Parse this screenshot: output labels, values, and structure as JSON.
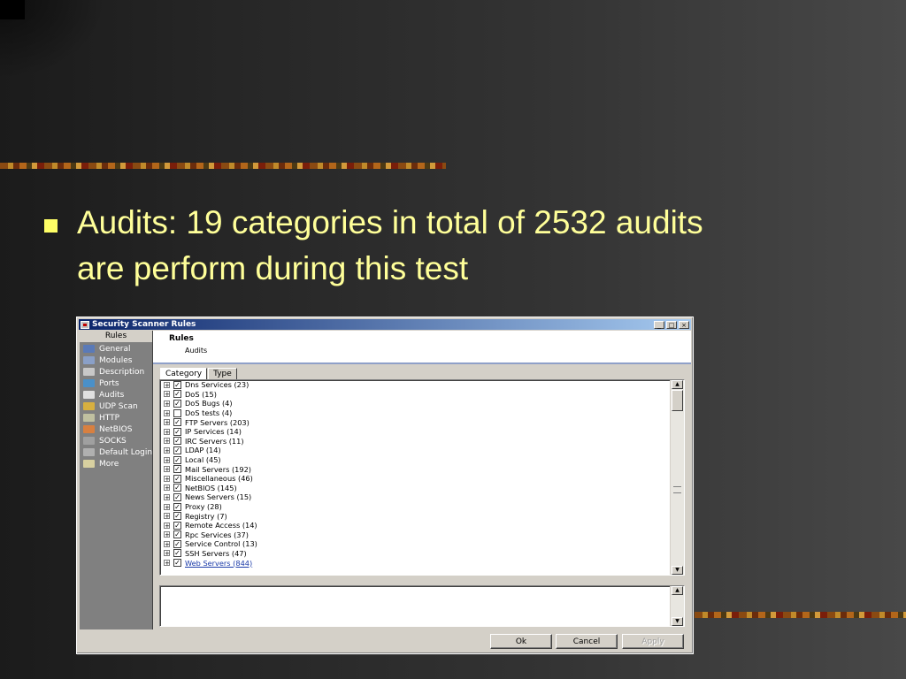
{
  "slide": {
    "bullet_text": "Audits: 19 categories in total of 2532 audits are perform during this test",
    "accent_color": "#ffff99"
  },
  "window": {
    "title": "Security Scanner Rules",
    "controls": {
      "minimize": "_",
      "maximize": "□",
      "close": "×"
    }
  },
  "sidebar": {
    "header": "Rules",
    "items": [
      {
        "label": "General",
        "icon": "general-icon",
        "color": "#5a7ab8"
      },
      {
        "label": "Modules",
        "icon": "modules-icon",
        "color": "#8aa0c8"
      },
      {
        "label": "Description",
        "icon": "description-icon",
        "color": "#c8c8c8"
      },
      {
        "label": "Ports",
        "icon": "ports-icon",
        "color": "#4a90c8"
      },
      {
        "label": "Audits",
        "icon": "audits-icon",
        "color": "#e0e0e0"
      },
      {
        "label": "UDP Scan",
        "icon": "udp-scan-icon",
        "color": "#d8b040"
      },
      {
        "label": "HTTP",
        "icon": "http-icon",
        "color": "#c0c0a0"
      },
      {
        "label": "NetBIOS",
        "icon": "netbios-icon",
        "color": "#d88040"
      },
      {
        "label": "SOCKS",
        "icon": "socks-icon",
        "color": "#a0a0a0"
      },
      {
        "label": "Default Logins",
        "icon": "default-logins-icon",
        "color": "#b0b0b0"
      },
      {
        "label": "More",
        "icon": "more-icon",
        "color": "#d8d0a0"
      }
    ]
  },
  "header": {
    "title": "Rules",
    "subtitle": "Audits"
  },
  "tabs": [
    {
      "label": "Category"
    },
    {
      "label": "Type"
    }
  ],
  "audits": [
    {
      "label": "Dns Services (23)",
      "checked": true
    },
    {
      "label": "DoS (15)",
      "checked": true
    },
    {
      "label": "DoS Bugs (4)",
      "checked": true
    },
    {
      "label": "DoS tests (4)",
      "checked": false
    },
    {
      "label": "FTP Servers (203)",
      "checked": true
    },
    {
      "label": "IP Services (14)",
      "checked": true
    },
    {
      "label": "IRC Servers (11)",
      "checked": true
    },
    {
      "label": "LDAP (14)",
      "checked": true
    },
    {
      "label": "Local (45)",
      "checked": true
    },
    {
      "label": "Mail Servers (192)",
      "checked": true
    },
    {
      "label": "Miscellaneous (46)",
      "checked": true
    },
    {
      "label": "NetBIOS (145)",
      "checked": true
    },
    {
      "label": "News Servers (15)",
      "checked": true
    },
    {
      "label": "Proxy (28)",
      "checked": true
    },
    {
      "label": "Registry (7)",
      "checked": true
    },
    {
      "label": "Remote Access (14)",
      "checked": true
    },
    {
      "label": "Rpc Services (37)",
      "checked": true
    },
    {
      "label": "Service Control (13)",
      "checked": true
    },
    {
      "label": "SSH Servers (47)",
      "checked": true
    },
    {
      "label": "Web Servers (844)",
      "checked": true,
      "link": true
    }
  ],
  "tree_glyphs": {
    "expander": "+",
    "check": "✓",
    "scroll_up": "▲",
    "scroll_down": "▼"
  },
  "buttons": {
    "ok": "Ok",
    "cancel": "Cancel",
    "apply": "Apply"
  }
}
